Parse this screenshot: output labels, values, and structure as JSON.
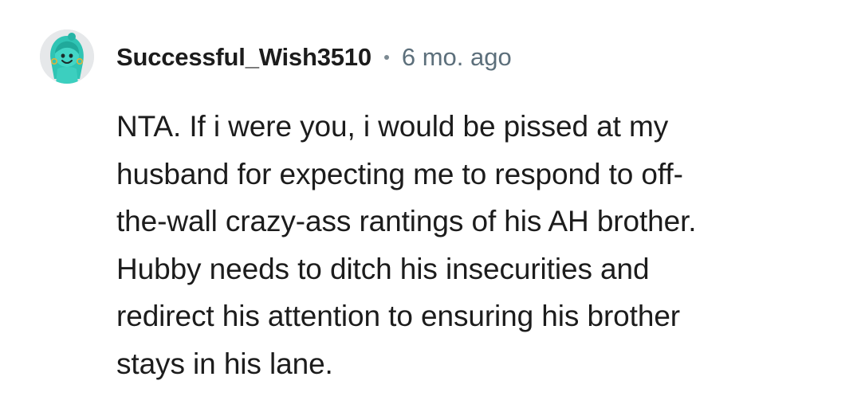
{
  "comment": {
    "author": "Successful_Wish3510",
    "separator": "•",
    "timestamp": "6 mo. ago",
    "avatar_icon": "snoo-avatar-icon",
    "body_lines": [
      "NTA. If i were you, i would be pissed at my",
      "husband for expecting me to respond to off-",
      "the-wall crazy-ass rantings of his AH brother.",
      "Hubby needs to ditch his insecurities and",
      "redirect his attention to ensuring his brother",
      "stays in his lane."
    ]
  },
  "colors": {
    "avatar_teal": "#3fcfc0",
    "username": "#1c1c1c",
    "timestamp": "#5c6f7b",
    "text": "#1c1c1c"
  }
}
